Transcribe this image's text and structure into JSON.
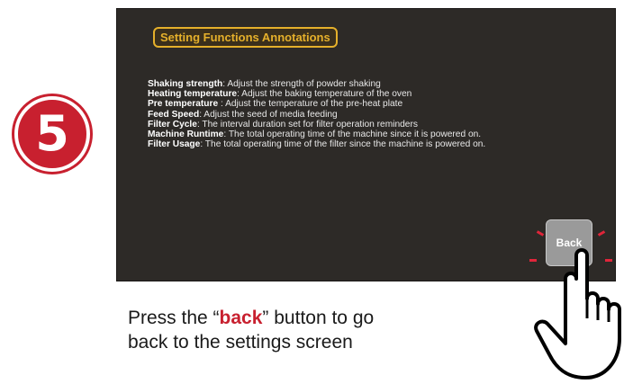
{
  "step": {
    "number": "5",
    "color": "#c8202f"
  },
  "screen": {
    "title": "Setting Functions Annotations",
    "annotations": [
      {
        "term": "Shaking strength",
        "desc": ": Adjust the strength of powder shaking"
      },
      {
        "term": "Heating temperature",
        "desc": ": Adjust the baking temperature of the oven"
      },
      {
        "term": "Pre temperature",
        "desc": " : Adjust the temperature of the pre-heat plate"
      },
      {
        "term": "Feed Speed",
        "desc": ": Adjust the seed of media feeding"
      },
      {
        "term": "Filter Cycle",
        "desc": ": The interval duration set for filter operation reminders"
      },
      {
        "term": "Machine Runtime",
        "desc": ": The total operating time of the machine since it is powered on."
      },
      {
        "term": "Filter Usage",
        "desc": ": The total operating time of the filter since the machine is powered on."
      }
    ],
    "back_button": "Back"
  },
  "caption": {
    "line1_pre": "Press the “",
    "highlight": "back",
    "line1_post": "” button to go",
    "line2": "back to the settings screen"
  },
  "icons": {
    "hand": "pointing-hand-icon"
  }
}
